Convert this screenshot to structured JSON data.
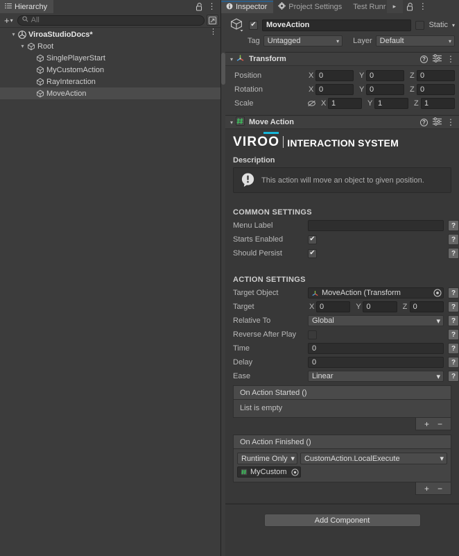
{
  "hierarchy": {
    "tab_label": "Hierarchy",
    "toolbar": {
      "add_label": "+",
      "add_caret": "▾",
      "search_placeholder": "All",
      "search_value": ""
    },
    "rows": [
      {
        "label": "ViroaStudioDocs*",
        "indent": 1,
        "twisty": "▾",
        "icon": "unity-scene-icon",
        "bold": true,
        "selected": false,
        "kebab": true
      },
      {
        "label": "Root",
        "indent": 2,
        "twisty": "▾",
        "icon": "gameobject-cube-icon",
        "bold": false,
        "selected": false,
        "kebab": false
      },
      {
        "label": "SinglePlayerStart",
        "indent": 3,
        "twisty": "",
        "icon": "gameobject-cube-icon",
        "bold": false,
        "selected": false,
        "kebab": false
      },
      {
        "label": "MyCustomAction",
        "indent": 3,
        "twisty": "",
        "icon": "gameobject-cube-icon",
        "bold": false,
        "selected": false,
        "kebab": false
      },
      {
        "label": "RayInteraction",
        "indent": 3,
        "twisty": "",
        "icon": "gameobject-cube-icon",
        "bold": false,
        "selected": false,
        "kebab": false
      },
      {
        "label": "MoveAction",
        "indent": 3,
        "twisty": "",
        "icon": "gameobject-cube-icon",
        "bold": false,
        "selected": true,
        "kebab": false
      }
    ]
  },
  "inspector": {
    "tabs": [
      {
        "label": "Inspector",
        "icon": "info-icon",
        "active": true
      },
      {
        "label": "Project Settings",
        "icon": "gear-icon",
        "active": false
      },
      {
        "label": "Test Runr",
        "icon": "none",
        "active": false
      }
    ],
    "tab_overflow": "▸",
    "object_header": {
      "enabled_checkmark": "✔",
      "name_value": "MoveAction",
      "static_label": "Static",
      "static_checked": false,
      "static_caret": "▾",
      "tag_label": "Tag",
      "tag_value": "Untagged",
      "layer_label": "Layer",
      "layer_value": "Default"
    },
    "transform": {
      "title": "Transform",
      "twisty": "▾",
      "rows": [
        {
          "name": "Position",
          "x": "0",
          "y": "0",
          "z": "0",
          "lock": false
        },
        {
          "name": "Rotation",
          "x": "0",
          "y": "0",
          "z": "0",
          "lock": false
        },
        {
          "name": "Scale",
          "x": "1",
          "y": "1",
          "z": "1",
          "lock": true
        }
      ],
      "axis_labels": [
        "X",
        "Y",
        "Z"
      ]
    },
    "move_action": {
      "title": "Move Action",
      "twisty": "▾",
      "brand": {
        "word": "VIROO",
        "subtitle": "INTERACTION SYSTEM",
        "accent_color": "#17b5d8"
      },
      "description_label": "Description",
      "description_text": "This action will move an object to given position.",
      "common_settings_label": "COMMON SETTINGS",
      "common_rows": [
        {
          "name": "Menu Label",
          "type": "text",
          "value": "",
          "help": "?"
        },
        {
          "name": "Starts Enabled",
          "type": "check",
          "checked": true,
          "help": "?"
        },
        {
          "name": "Should Persist",
          "type": "check",
          "checked": true,
          "help": "?"
        }
      ],
      "action_settings_label": "ACTION SETTINGS",
      "target_object": {
        "name": "Target Object",
        "value": "MoveAction (Transform",
        "help": "?"
      },
      "target_vector": {
        "name": "Target",
        "x": "0",
        "y": "0",
        "z": "0",
        "help": "?"
      },
      "relative_to": {
        "name": "Relative To",
        "value": "Global",
        "help": "?"
      },
      "reverse_after_play": {
        "name": "Reverse After Play",
        "checked": false,
        "help": "?"
      },
      "time": {
        "name": "Time",
        "value": "0",
        "help": "?"
      },
      "delay": {
        "name": "Delay",
        "value": "0",
        "help": "?"
      },
      "ease": {
        "name": "Ease",
        "value": "Linear",
        "help": "?"
      },
      "on_started": {
        "title": "On Action Started ()",
        "empty_text": "List is empty",
        "add_label": "+",
        "remove_label": "−"
      },
      "on_finished": {
        "title": "On Action Finished ()",
        "mode_value": "Runtime Only",
        "function_value": "CustomAction.LocalExecute",
        "object_value": "MyCustom",
        "add_label": "+",
        "remove_label": "−"
      }
    },
    "add_component_label": "Add Component"
  }
}
